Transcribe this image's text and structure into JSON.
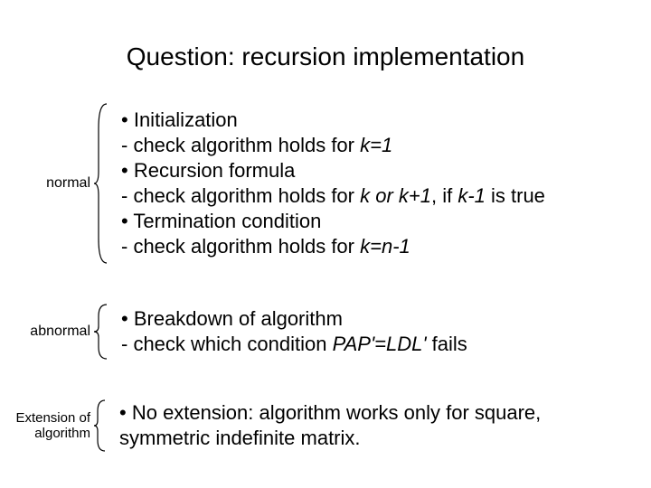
{
  "title": "Question: recursion implementation",
  "sections": {
    "normal": {
      "label": "normal",
      "items": [
        {
          "head": "Initialization",
          "sub_pre": "- check algorithm holds for ",
          "sub_em": "k=1",
          "sub_post": ""
        },
        {
          "head": "Recursion formula",
          "sub_pre": "- check algorithm holds for ",
          "sub_em": "k or k+1",
          "sub_post": ", if ",
          "sub_em2": "k-1",
          "sub_post2": " is true"
        },
        {
          "head": "Termination condition",
          "sub_pre": "- check algorithm holds for ",
          "sub_em": "k=n-1",
          "sub_post": ""
        }
      ]
    },
    "abnormal": {
      "label": "abnormal",
      "items": [
        {
          "head": "Breakdown of algorithm",
          "sub_pre": "- check which condition ",
          "sub_em": "PAP'=LDL'",
          "sub_post": " fails"
        }
      ]
    },
    "extension": {
      "label": "Extension of algorithm",
      "items": [
        {
          "head": "No extension: algorithm works only for square, symmetric indefinite matrix.",
          "sub_pre": "",
          "sub_em": "",
          "sub_post": ""
        }
      ]
    }
  }
}
